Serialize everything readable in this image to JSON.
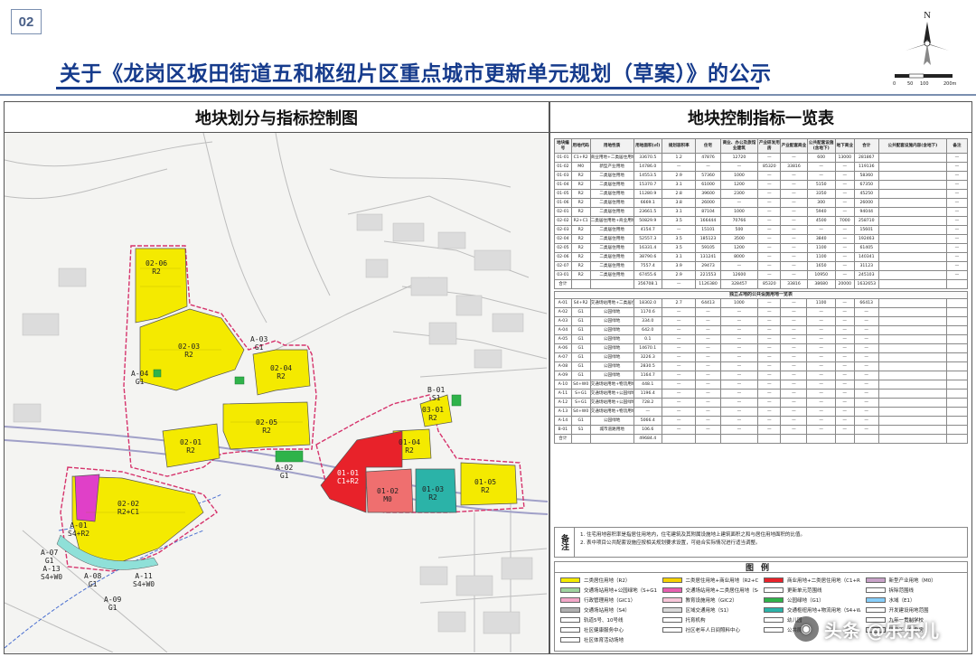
{
  "header": {
    "page_no": "02",
    "title": "关于《龙岗区坂田街道五和枢纽片区重点城市更新单元规划（草案）》的公示",
    "scale_labels": [
      "0",
      "50",
      "100",
      "200m"
    ],
    "north_label": "N"
  },
  "left_panel": {
    "title": "地块划分与指标控制图",
    "plots": [
      {
        "id": "02-06",
        "sub": "R2"
      },
      {
        "id": "02-03",
        "sub": "R2"
      },
      {
        "id": "02-04",
        "sub": "R2"
      },
      {
        "id": "02-05",
        "sub": "R2"
      },
      {
        "id": "02-01",
        "sub": "R2"
      },
      {
        "id": "02-02",
        "sub": "R2+C1"
      },
      {
        "id": "03-01",
        "sub": "R2"
      },
      {
        "id": "01-01",
        "sub": "C1+R2"
      },
      {
        "id": "01-02",
        "sub": "M0"
      },
      {
        "id": "01-04",
        "sub": "R2"
      },
      {
        "id": "01-03",
        "sub": "R2"
      },
      {
        "id": "01-05",
        "sub": "R2"
      },
      {
        "id": "A-01",
        "sub": "S4+R2"
      },
      {
        "id": "A-03",
        "sub": "G1"
      },
      {
        "id": "A-04",
        "sub": "G1"
      },
      {
        "id": "A-02",
        "sub": "G1"
      },
      {
        "id": "A-07",
        "sub": "G1"
      },
      {
        "id": "A-08",
        "sub": "G1"
      },
      {
        "id": "A-09",
        "sub": "G1"
      },
      {
        "id": "A-13",
        "sub": "S4+W0"
      },
      {
        "id": "A-11",
        "sub": "S4+W0"
      },
      {
        "id": "B-01",
        "sub": "S1"
      }
    ]
  },
  "right_panel": {
    "title": "地块控制指标一览表",
    "headers": [
      "地块编号",
      "用地代码",
      "用地性质",
      "用地面积(㎡)",
      "规划容积率",
      "住宅",
      "商业、办公及旅馆业建筑",
      "产业研发用房",
      "产业配套商业",
      "公共配套设施(含地下)",
      "地下商业",
      "合计",
      "公共配套设施内容(含地下)",
      "备注"
    ],
    "rows": [
      [
        "01-01",
        "C1+R2",
        "商业用地+二类居住用地",
        "33670.5",
        "1.2",
        "47876",
        "12720",
        "—",
        "—",
        "600",
        "13000",
        "281867",
        "",
        "—"
      ],
      [
        "01-02",
        "M0",
        "新型产业用地",
        "14786.0",
        "—",
        "—",
        "—",
        "85320",
        "33816",
        "—",
        "—",
        "119136",
        "",
        "—"
      ],
      [
        "01-03",
        "R2",
        "二类居住用地",
        "14553.5",
        "2.9",
        "57360",
        "1000",
        "—",
        "—",
        "—",
        "—",
        "58360",
        "",
        "—"
      ],
      [
        "01-04",
        "R2",
        "二类居住用地",
        "15370.7",
        "3.1",
        "61000",
        "1200",
        "—",
        "—",
        "5150",
        "—",
        "67350",
        "",
        "—"
      ],
      [
        "01-05",
        "R2",
        "二类居住用地",
        "11280.9",
        "2.8",
        "39600",
        "2300",
        "—",
        "—",
        "3350",
        "—",
        "45250",
        "",
        "—"
      ],
      [
        "01-06",
        "R2",
        "二类居住用地",
        "6669.1",
        "3.8",
        "26000",
        "—",
        "—",
        "—",
        "300",
        "—",
        "26000",
        "",
        "—"
      ],
      [
        "02-01",
        "R2",
        "二类居住用地",
        "23661.5",
        "3.1",
        "87104",
        "1000",
        "—",
        "—",
        "5940",
        "—",
        "94044",
        "",
        "—"
      ],
      [
        "02-02",
        "R2+C1",
        "二类居住用地+商业用地",
        "50829.9",
        "3.5",
        "166444",
        "70766",
        "—",
        "—",
        "4500",
        "7000",
        "258710",
        "",
        "—"
      ],
      [
        "02-03",
        "R2",
        "二类居住用地",
        "4154.7",
        "—",
        "15101",
        "500",
        "—",
        "—",
        "—",
        "—",
        "15601",
        "",
        "—"
      ],
      [
        "02-04",
        "R2",
        "二类居住用地",
        "52557.3",
        "3.5",
        "185123",
        "3500",
        "—",
        "—",
        "3840",
        "—",
        "192463",
        "",
        "—"
      ],
      [
        "02-05",
        "R2",
        "二类居住用地",
        "16331.4",
        "3.5",
        "59105",
        "1200",
        "—",
        "—",
        "1100",
        "—",
        "61405",
        "",
        "—"
      ],
      [
        "02-06",
        "R2",
        "二类居住用地",
        "38790.6",
        "3.1",
        "131241",
        "8000",
        "—",
        "—",
        "1100",
        "—",
        "140341",
        "",
        "—"
      ],
      [
        "02-07",
        "R2",
        "二类居住用地",
        "7557.4",
        "3.9",
        "29473",
        "—",
        "—",
        "—",
        "1650",
        "—",
        "31123",
        "",
        "—"
      ],
      [
        "03-01",
        "R2",
        "二类居住用地",
        "67455.6",
        "2.9",
        "221553",
        "12600",
        "—",
        "—",
        "10950",
        "—",
        "245103",
        "",
        "—"
      ],
      [
        "合计",
        "",
        "",
        "356708.1",
        "—",
        "1126380",
        "328457",
        "85320",
        "33816",
        "38680",
        "20000",
        "1632653",
        "",
        ""
      ]
    ],
    "section2_title": "独立占地的公共设施用地一览表",
    "rows2": [
      [
        "A-01",
        "S4+R2",
        "交通场站用地+二类居住用地",
        "18302.0",
        "2.7",
        "64413",
        "1000",
        "—",
        "—",
        "1100",
        "—",
        "66413",
        "",
        ""
      ],
      [
        "A-02",
        "G1",
        "公园绿地",
        "1170.6",
        "—",
        "—",
        "—",
        "—",
        "—",
        "—",
        "—",
        "—",
        "",
        ""
      ],
      [
        "A-03",
        "G1",
        "公园绿地",
        "334.0",
        "—",
        "—",
        "—",
        "—",
        "—",
        "—",
        "—",
        "—",
        "",
        ""
      ],
      [
        "A-04",
        "G1",
        "公园绿地",
        "642.0",
        "—",
        "—",
        "—",
        "—",
        "—",
        "—",
        "—",
        "—",
        "",
        ""
      ],
      [
        "A-05",
        "G1",
        "公园绿地",
        "0.1",
        "—",
        "—",
        "—",
        "—",
        "—",
        "—",
        "—",
        "—",
        "",
        ""
      ],
      [
        "A-06",
        "G1",
        "公园绿地",
        "14670.1",
        "—",
        "—",
        "—",
        "—",
        "—",
        "—",
        "—",
        "—",
        "",
        ""
      ],
      [
        "A-07",
        "G1",
        "公园绿地",
        "3226.3",
        "—",
        "—",
        "—",
        "—",
        "—",
        "—",
        "—",
        "—",
        "",
        ""
      ],
      [
        "A-08",
        "G1",
        "公园绿地",
        "2830.5",
        "—",
        "—",
        "—",
        "—",
        "—",
        "—",
        "—",
        "—",
        "",
        ""
      ],
      [
        "A-09",
        "G1",
        "公园绿地",
        "1164.7",
        "—",
        "—",
        "—",
        "—",
        "—",
        "—",
        "—",
        "—",
        "",
        ""
      ],
      [
        "A-10",
        "S4+W0",
        "交通场站用地+物流用地",
        "448.1",
        "—",
        "—",
        "—",
        "—",
        "—",
        "—",
        "—",
        "—",
        "",
        ""
      ],
      [
        "A-11",
        "S+G1",
        "交通场站用地+公园绿地",
        "1196.4",
        "—",
        "—",
        "—",
        "—",
        "—",
        "—",
        "—",
        "—",
        "",
        ""
      ],
      [
        "A-12",
        "S+G1",
        "交通场站用地+公园绿地",
        "728.2",
        "—",
        "—",
        "—",
        "—",
        "—",
        "—",
        "—",
        "—",
        "",
        ""
      ],
      [
        "A-13",
        "S4+W0",
        "交通场站用地+物流用地",
        "—",
        "—",
        "—",
        "—",
        "—",
        "—",
        "—",
        "—",
        "—",
        "",
        ""
      ],
      [
        "A-14",
        "G1",
        "公园绿地",
        "5066.4",
        "—",
        "—",
        "—",
        "—",
        "—",
        "—",
        "—",
        "—",
        "",
        ""
      ],
      [
        "B-01",
        "S1",
        "城市道路用地",
        "106.6",
        "—",
        "—",
        "—",
        "—",
        "—",
        "—",
        "—",
        "—",
        "",
        ""
      ],
      [
        "合计",
        "",
        "",
        "49684.4",
        "",
        "",
        "",
        "",
        "",
        "",
        "",
        "",
        "",
        ""
      ]
    ],
    "notes_label": "备注",
    "notes": [
      "1. 住宅用地容积率是指居住用地内，住宅建筑及其附属设施地上建筑面积之和与居住用地面积的比值。",
      "2. 表中项目公共配套设施应按相关规划要求设置，可结合实际情况进行适当调整。"
    ],
    "legend_title": "图例",
    "legend": [
      {
        "label": "二类居住用地（R2）",
        "color": "#f4ea00"
      },
      {
        "label": "二类居住用地+商业用地（R2+C1）",
        "color": "#f6d200"
      },
      {
        "label": "商业用地+二类居住用地（C1+R2）",
        "color": "#e8222a"
      },
      {
        "label": "新型产业用地（M0）",
        "color": "#c8a2c8"
      },
      {
        "label": "交通场站用地+公园绿地（S+G1）",
        "color": "#9fd3a0"
      },
      {
        "label": "交通场站用地+二类居住用地（S4+R2）",
        "color": "#e75fb0"
      },
      {
        "label": "更新单元范围线",
        "color": "#ffffff"
      },
      {
        "label": "拆除范围线",
        "color": "#ffffff"
      },
      {
        "label": "行政管理用地（GIC1）",
        "color": "#f2a7c8"
      },
      {
        "label": "教育设施用地（GIC2）",
        "color": "#f7c6d9"
      },
      {
        "label": "公园绿地（G1）",
        "color": "#2fb34a"
      },
      {
        "label": "水域（E1）",
        "color": "#87cefa"
      },
      {
        "label": "交通场站用地（S4）",
        "color": "#b0b0b0"
      },
      {
        "label": "区域交通用地（S1）",
        "color": "#d9d9d9"
      },
      {
        "label": "交通枢纽用地+物流用地（S4+W0）",
        "color": "#2bb3a8"
      },
      {
        "label": "开发建设用地范围",
        "color": "#ffffff"
      },
      {
        "label": "轨道5号、10号线",
        "color": "#ffffff"
      },
      {
        "label": "托育机构",
        "color": "#ffffff"
      },
      {
        "label": "幼儿园",
        "color": "#ffffff"
      },
      {
        "label": "九年一贯制学校",
        "color": "#ffffff"
      },
      {
        "label": "社区健康服务中心",
        "color": "#ffffff"
      },
      {
        "label": "社区老年人日间照料中心",
        "color": "#ffffff"
      },
      {
        "label": "公共厕所",
        "color": "#ffffff"
      },
      {
        "label": "环卫工人作息房",
        "color": "#ffffff"
      },
      {
        "label": "社区体育活动场地",
        "color": "#ffffff"
      }
    ]
  },
  "watermark": {
    "text": "头条 @乐乐儿"
  },
  "colors": {
    "title_blue": "#163b8c",
    "residential_yellow": "#f4ea00",
    "commercial_red": "#e8222a",
    "green": "#2fb34a",
    "teal": "#2bb3a8",
    "magenta": "#e040c8"
  }
}
